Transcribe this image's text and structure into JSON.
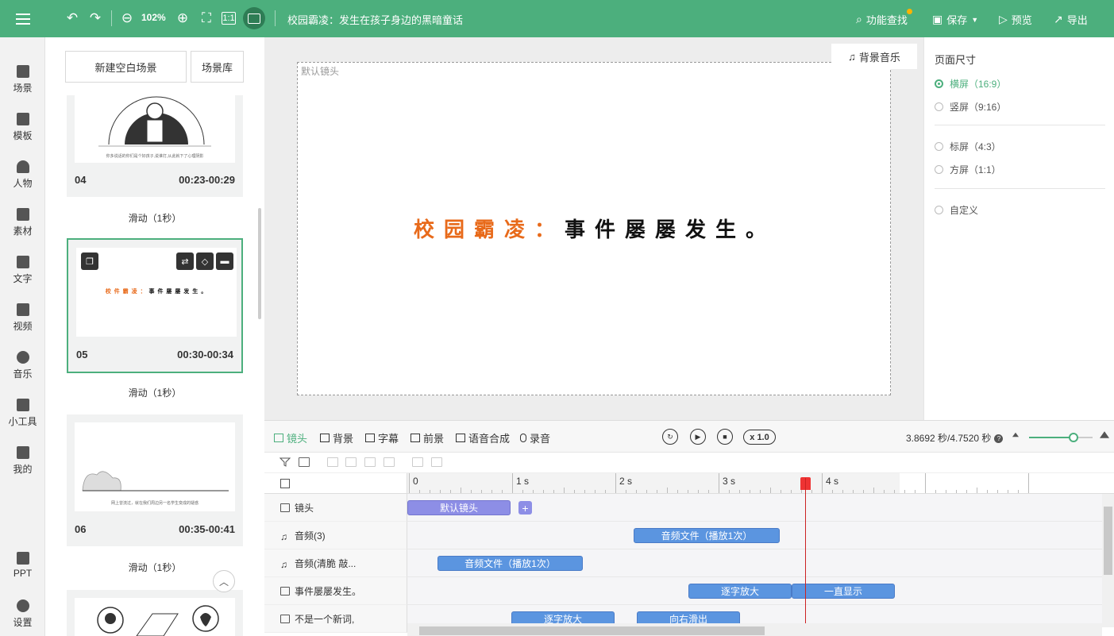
{
  "toolbar": {
    "zoom": "102%",
    "doc_title": "校园霸凌：发生在孩子身边的黑暗童话",
    "feature_search": "功能查找",
    "save": "保存",
    "preview": "预览",
    "export": "导出"
  },
  "nav": {
    "items": [
      {
        "label": "场景"
      },
      {
        "label": "模板"
      },
      {
        "label": "人物"
      },
      {
        "label": "素材"
      },
      {
        "label": "文字"
      },
      {
        "label": "视频"
      },
      {
        "label": "音乐"
      },
      {
        "label": "小工具"
      },
      {
        "label": "我的"
      },
      {
        "label": "PPT"
      },
      {
        "label": "设置"
      }
    ]
  },
  "scenes": {
    "new_blank": "新建空白场景",
    "library": "场景库",
    "cards": [
      {
        "num": "04",
        "time": "00:23-00:29",
        "caption": "你多说话的你们是个好孩子,说谁打,从此就下了心理阴影"
      },
      {
        "num": "05",
        "time": "00:30-00:34",
        "caption_orange": "校 件 霸 凌 ：",
        "caption_black": "事 件 屡 屡 发 生 。"
      },
      {
        "num": "06",
        "time": "00:35-00:41",
        "caption": "网上曾流过，就在我们周边另一名学生变成的疑惑"
      }
    ],
    "transition": "滑动（1秒）"
  },
  "canvas": {
    "camera_label": "默认镜头",
    "music_button": "背景音乐",
    "headline_orange": "校园霸凌：",
    "headline_black": "事件屡屡发生。"
  },
  "props": {
    "title": "页面尺寸",
    "options": [
      {
        "label": "横屏（16:9）",
        "selected": true
      },
      {
        "label": "竖屏（9:16）",
        "selected": false
      },
      {
        "label": "标屏（4:3）",
        "selected": false
      },
      {
        "label": "方屏（1:1）",
        "selected": false
      },
      {
        "label": "自定义",
        "selected": false
      }
    ]
  },
  "timeline": {
    "tabs": [
      "镜头",
      "背景",
      "字幕",
      "前景",
      "语音合成",
      "录音"
    ],
    "speed": "x 1.0",
    "time_readout": "3.8692 秒/4.7520 秒",
    "ruler": [
      "0",
      "1 s",
      "2 s",
      "3 s",
      "4 s"
    ],
    "zoom_level": 0.7,
    "tracks": [
      {
        "label": "镜头",
        "clips": [
          "默认镜头"
        ]
      },
      {
        "label": "音频(3)",
        "clips": [
          "音频文件（播放1次）"
        ]
      },
      {
        "label": "音频(清脆 敲...",
        "clips": [
          "音频文件（播放1次）"
        ]
      },
      {
        "label": "事件屡屡发生。",
        "clips": [
          "逐字放大",
          "一直显示"
        ]
      },
      {
        "label": "不是一个新词,",
        "clips": [
          "逐字放大",
          "向右滑出"
        ]
      }
    ]
  },
  "colors": {
    "accent": "#4caf7d",
    "clip_blue": "#5b95e0",
    "clip_purple": "#8d8ee6",
    "headline_orange": "#e86a1a",
    "playhead": "#cc2222"
  }
}
